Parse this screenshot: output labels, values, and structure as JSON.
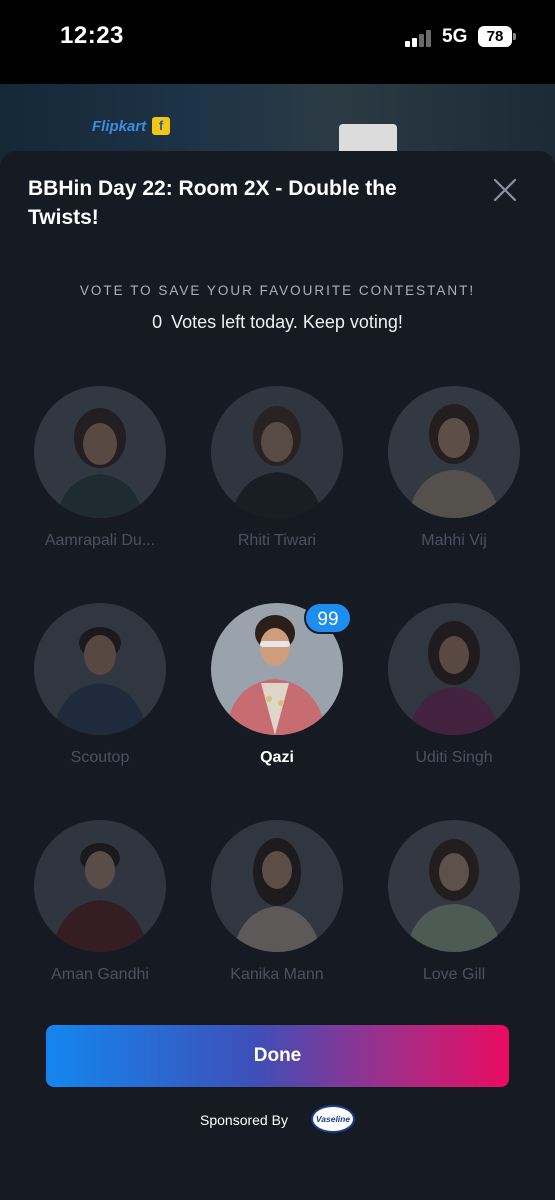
{
  "status_bar": {
    "time": "12:23",
    "network": "5G",
    "battery": "78"
  },
  "background_app": {
    "brand": "Flipkart",
    "brand_icon": "f"
  },
  "sheet": {
    "title": "BBHin Day 22: Room 2X - Double the Twists!",
    "subheading": "VOTE TO SAVE YOUR FAVOURITE CONTESTANT!",
    "votes_count": "0",
    "votes_text": "Votes left today. Keep voting!",
    "contestants": [
      {
        "name": "Aamrapali Du...",
        "selected": false
      },
      {
        "name": "Rhiti Tiwari",
        "selected": false
      },
      {
        "name": "Mahhi Vij",
        "selected": false
      },
      {
        "name": "Scoutop",
        "selected": false
      },
      {
        "name": "Qazi",
        "selected": true,
        "votes": "99"
      },
      {
        "name": "Uditi Singh",
        "selected": false
      },
      {
        "name": "Aman Gandhi",
        "selected": false
      },
      {
        "name": "Kanika Mann",
        "selected": false
      },
      {
        "name": "Love Gill",
        "selected": false
      }
    ],
    "done_label": "Done",
    "sponsor_label": "Sponsored By",
    "sponsor_brand": "Vaseline"
  },
  "colors": {
    "sheet_bg": "#161b23",
    "badge": "#1e8df0",
    "gradient_start": "#1387ef",
    "gradient_end": "#ea0b62"
  }
}
